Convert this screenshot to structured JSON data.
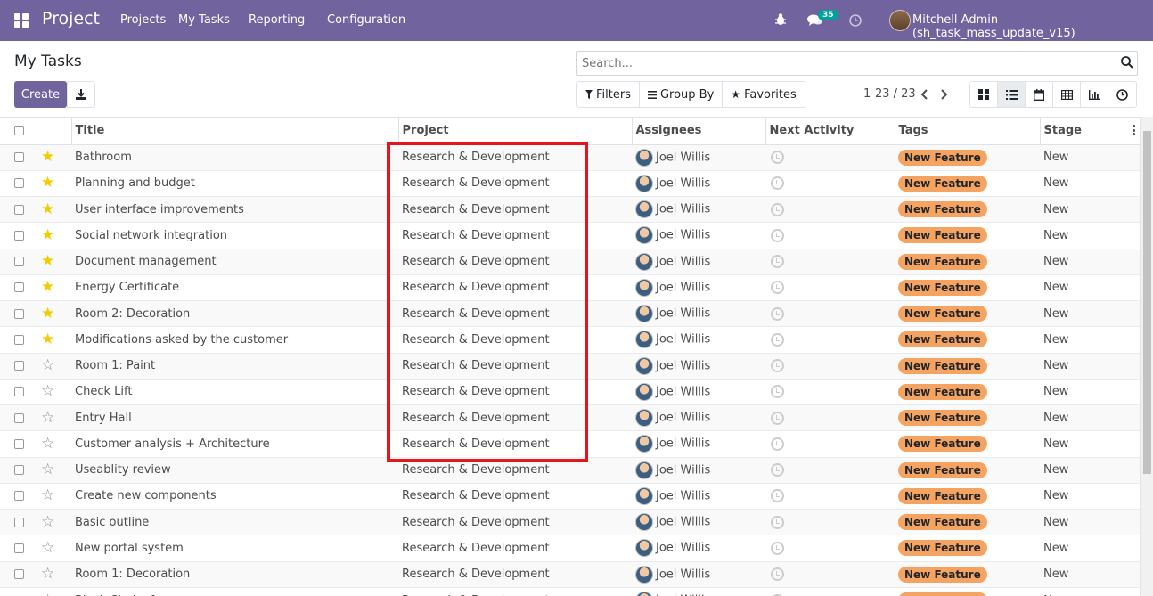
{
  "navbar": {
    "brand": "Project",
    "menu": [
      "Projects",
      "My Tasks",
      "Reporting",
      "Configuration"
    ],
    "message_count": "35",
    "user_name": "Mitchell Admin (sh_task_mass_update_v15)"
  },
  "control_panel": {
    "title": "My Tasks",
    "create_label": "Create",
    "search_placeholder": "Search...",
    "filters_label": "Filters",
    "group_by_label": "Group By",
    "favorites_label": "Favorites",
    "pager": "1-23 / 23"
  },
  "table": {
    "columns": [
      "Title",
      "Project",
      "Assignees",
      "Next Activity",
      "Tags",
      "Stage"
    ],
    "rows": [
      {
        "starred": true,
        "title": "Bathroom",
        "project": "Research & Development",
        "assignee": "Joel Willis",
        "tag": "New Feature",
        "stage": "New"
      },
      {
        "starred": true,
        "title": "Planning and budget",
        "project": "Research & Development",
        "assignee": "Joel Willis",
        "tag": "New Feature",
        "stage": "New"
      },
      {
        "starred": true,
        "title": "User interface improvements",
        "project": "Research & Development",
        "assignee": "Joel Willis",
        "tag": "New Feature",
        "stage": "New"
      },
      {
        "starred": true,
        "title": "Social network integration",
        "project": "Research & Development",
        "assignee": "Joel Willis",
        "tag": "New Feature",
        "stage": "New"
      },
      {
        "starred": true,
        "title": "Document management",
        "project": "Research & Development",
        "assignee": "Joel Willis",
        "tag": "New Feature",
        "stage": "New"
      },
      {
        "starred": true,
        "title": "Energy Certificate",
        "project": "Research & Development",
        "assignee": "Joel Willis",
        "tag": "New Feature",
        "stage": "New"
      },
      {
        "starred": true,
        "title": "Room 2: Decoration",
        "project": "Research & Development",
        "assignee": "Joel Willis",
        "tag": "New Feature",
        "stage": "New"
      },
      {
        "starred": true,
        "title": "Modifications asked by the customer",
        "project": "Research & Development",
        "assignee": "Joel Willis",
        "tag": "New Feature",
        "stage": "New"
      },
      {
        "starred": false,
        "title": "Room 1: Paint",
        "project": "Research & Development",
        "assignee": "Joel Willis",
        "tag": "New Feature",
        "stage": "New"
      },
      {
        "starred": false,
        "title": "Check Lift",
        "project": "Research & Development",
        "assignee": "Joel Willis",
        "tag": "New Feature",
        "stage": "New"
      },
      {
        "starred": false,
        "title": "Entry Hall",
        "project": "Research & Development",
        "assignee": "Joel Willis",
        "tag": "New Feature",
        "stage": "New"
      },
      {
        "starred": false,
        "title": "Customer analysis + Architecture",
        "project": "Research & Development",
        "assignee": "Joel Willis",
        "tag": "New Feature",
        "stage": "New"
      },
      {
        "starred": false,
        "title": "Useablity review",
        "project": "Research & Development",
        "assignee": "Joel Willis",
        "tag": "New Feature",
        "stage": "New"
      },
      {
        "starred": false,
        "title": "Create new components",
        "project": "Research & Development",
        "assignee": "Joel Willis",
        "tag": "New Feature",
        "stage": "New"
      },
      {
        "starred": false,
        "title": "Basic outline",
        "project": "Research & Development",
        "assignee": "Joel Willis",
        "tag": "New Feature",
        "stage": "New"
      },
      {
        "starred": false,
        "title": "New portal system",
        "project": "Research & Development",
        "assignee": "Joel Willis",
        "tag": "New Feature",
        "stage": "New"
      },
      {
        "starred": false,
        "title": "Room 1: Decoration",
        "project": "Research & Development",
        "assignee": "Joel Willis",
        "tag": "New Feature",
        "stage": "New"
      },
      {
        "starred": false,
        "title": "Black Chairs for ...",
        "project": "Research & Development",
        "assignee": "Joel Willis",
        "tag": "New Feature",
        "stage": "New"
      }
    ]
  },
  "colors": {
    "navbar": "#71639e",
    "tag": "#f4a460",
    "star_on": "#f3cc00",
    "highlight": "#e4151c"
  }
}
